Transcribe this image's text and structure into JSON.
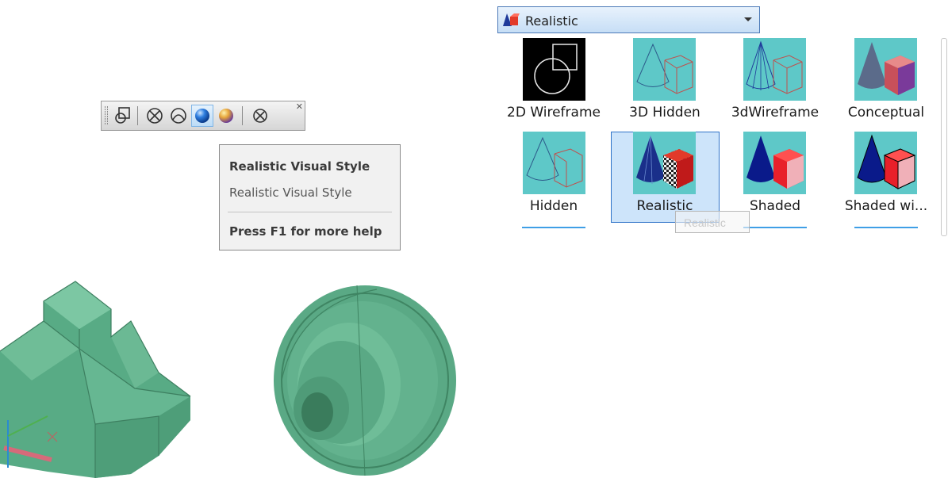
{
  "dropdown": {
    "label": "Realistic"
  },
  "tooltip": {
    "title": "Realistic Visual Style",
    "description": "Realistic Visual Style",
    "help": "Press F1 for more help"
  },
  "gallery": {
    "items": [
      {
        "label": "2D Wireframe"
      },
      {
        "label": "3D Hidden"
      },
      {
        "label": "3dWireframe"
      },
      {
        "label": "Conceptual"
      },
      {
        "label": "Hidden"
      },
      {
        "label": "Realistic"
      },
      {
        "label": "Shaded"
      },
      {
        "label": "Shaded wi..."
      }
    ],
    "drag_label": "Realistic"
  },
  "colors": {
    "model_green": "#5fae8a",
    "thumb_cyan": "#5ec8c8",
    "selection_blue": "#cde4fa",
    "accent_blue": "#2f73c8"
  }
}
